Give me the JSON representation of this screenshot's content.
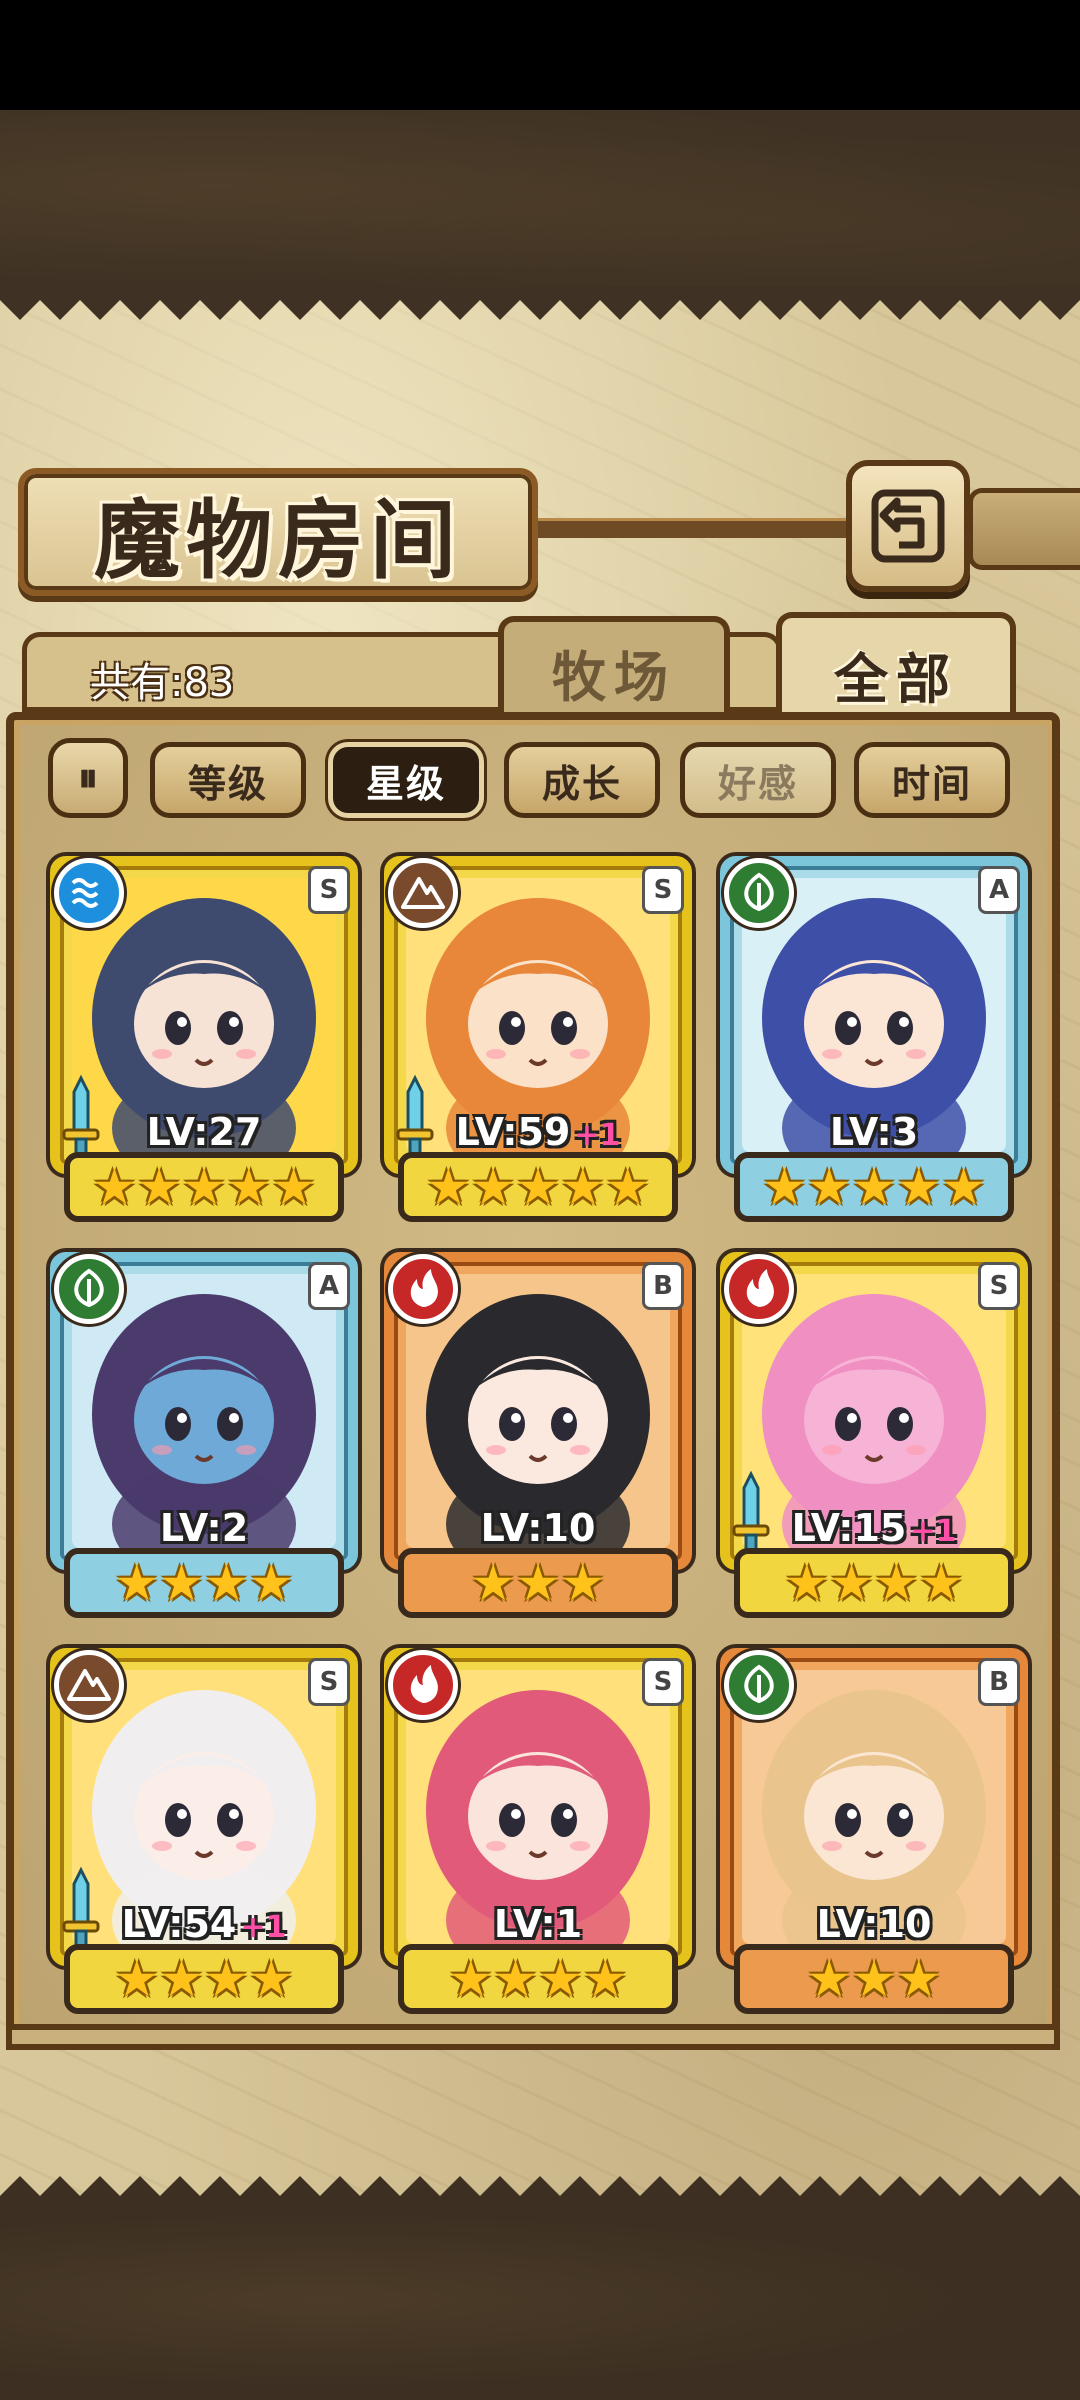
{
  "screen": {
    "title": "魔物房间",
    "count_label": "共有:83",
    "tabs": [
      {
        "label": "牧场",
        "active": false
      },
      {
        "label": "全部",
        "active": true
      }
    ],
    "sort_toggle_label": "⏸",
    "sort_buttons": [
      {
        "label": "等级",
        "state": "normal"
      },
      {
        "label": "星级",
        "state": "active"
      },
      {
        "label": "成长",
        "state": "normal"
      },
      {
        "label": "好感",
        "state": "faded"
      },
      {
        "label": "时间",
        "state": "normal"
      }
    ]
  },
  "monsters": [
    {
      "element": "water",
      "rank": "S",
      "level": "LV:27",
      "bonus": "",
      "stars": "★★★★★",
      "frame": "gold",
      "weapon": true,
      "hair": "#3e4a6e",
      "skin": "#f7e3d6",
      "bg": "#ffd84a"
    },
    {
      "element": "earth",
      "rank": "S",
      "level": "LV:59",
      "bonus": "+1",
      "stars": "★★★★★",
      "frame": "gold",
      "weapon": true,
      "hair": "#e8863a",
      "skin": "#fbe1c8",
      "bg": "#ffe07a"
    },
    {
      "element": "wood",
      "rank": "A",
      "level": "LV:3",
      "bonus": "",
      "stars": "★★★★★",
      "frame": "blue",
      "weapon": false,
      "hair": "#3e4fa8",
      "skin": "#fbe6d6",
      "bg": "#d9f0f6"
    },
    {
      "element": "wood",
      "rank": "A",
      "level": "LV:2",
      "bonus": "",
      "stars": "★★★★",
      "frame": "blue",
      "weapon": false,
      "hair": "#4a3b6c",
      "skin": "#6fa9d8",
      "bg": "#cfeaf4"
    },
    {
      "element": "fire",
      "rank": "B",
      "level": "LV:10",
      "bonus": "",
      "stars": "★★★",
      "frame": "bronze",
      "weapon": false,
      "hair": "#2a2a2e",
      "skin": "#fbe9e0",
      "bg": "#f6c58c"
    },
    {
      "element": "fire",
      "rank": "S",
      "level": "LV:15",
      "bonus": "+1",
      "stars": "★★★★",
      "frame": "gold",
      "weapon": true,
      "hair": "#f08fc2",
      "skin": "#f7b3d6",
      "bg": "#ffe37a"
    },
    {
      "element": "earth",
      "rank": "S",
      "level": "LV:54",
      "bonus": "+1",
      "stars": "★★★★",
      "frame": "gold",
      "weapon": true,
      "hair": "#f1eef0",
      "skin": "#fbeee8",
      "bg": "#ffe07a"
    },
    {
      "element": "fire",
      "rank": "S",
      "level": "LV:1",
      "bonus": "",
      "stars": "★★★★",
      "frame": "gold",
      "weapon": false,
      "hair": "#e25a7a",
      "skin": "#fbe4dc",
      "bg": "#ffe07a"
    },
    {
      "element": "wood",
      "rank": "B",
      "level": "LV:10",
      "bonus": "",
      "stars": "★★★",
      "frame": "bronze",
      "weapon": false,
      "hair": "#e9c48c",
      "skin": "#fbe6d4",
      "bg": "#f7c996"
    }
  ],
  "colors": {
    "water": "#1d8fdc",
    "earth": "#7a4a2c",
    "wood": "#2e7d32",
    "fire": "#c62828"
  }
}
